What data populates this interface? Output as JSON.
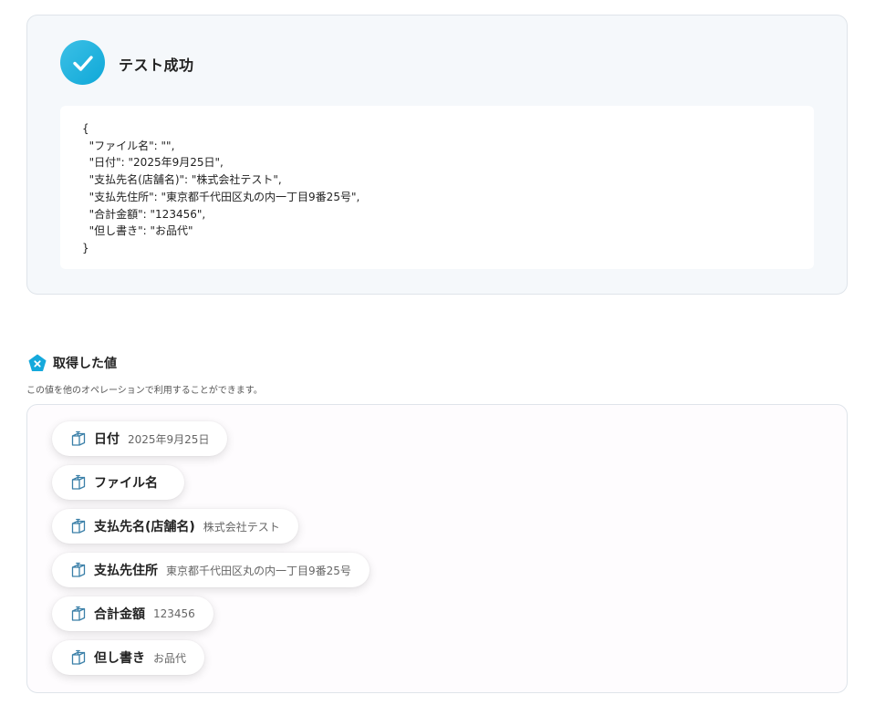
{
  "result": {
    "title": "テスト成功",
    "json_lines": [
      "{",
      "  \"ファイル名\": \"\",",
      "  \"日付\": \"2025年9月25日\",",
      "  \"支払先名(店舗名)\": \"株式会社テスト\",",
      "  \"支払先住所\": \"東京都千代田区丸の内一丁目9番25号\",",
      "  \"合計金額\": \"123456\",",
      "  \"但し書き\": \"お品代\"",
      "}"
    ]
  },
  "values_section": {
    "title": "取得した値",
    "description": "この値を他のオペレーションで利用することができます。",
    "items": [
      {
        "label": "日付",
        "value": "2025年9月25日"
      },
      {
        "label": "ファイル名",
        "value": ""
      },
      {
        "label": "支払先名(店舗名)",
        "value": "株式会社テスト"
      },
      {
        "label": "支払先住所",
        "value": "東京都千代田区丸の内一丁目9番25号"
      },
      {
        "label": "合計金額",
        "value": "123456"
      },
      {
        "label": "但し書き",
        "value": "お品代"
      }
    ]
  },
  "icons": {
    "success": "check-icon",
    "section": "pentagon-x-icon",
    "chip": "copy-box-icon"
  },
  "colors": {
    "accent": "#0fa8d8",
    "card_bg": "#f5f8fb",
    "border": "#dfe4ea"
  }
}
